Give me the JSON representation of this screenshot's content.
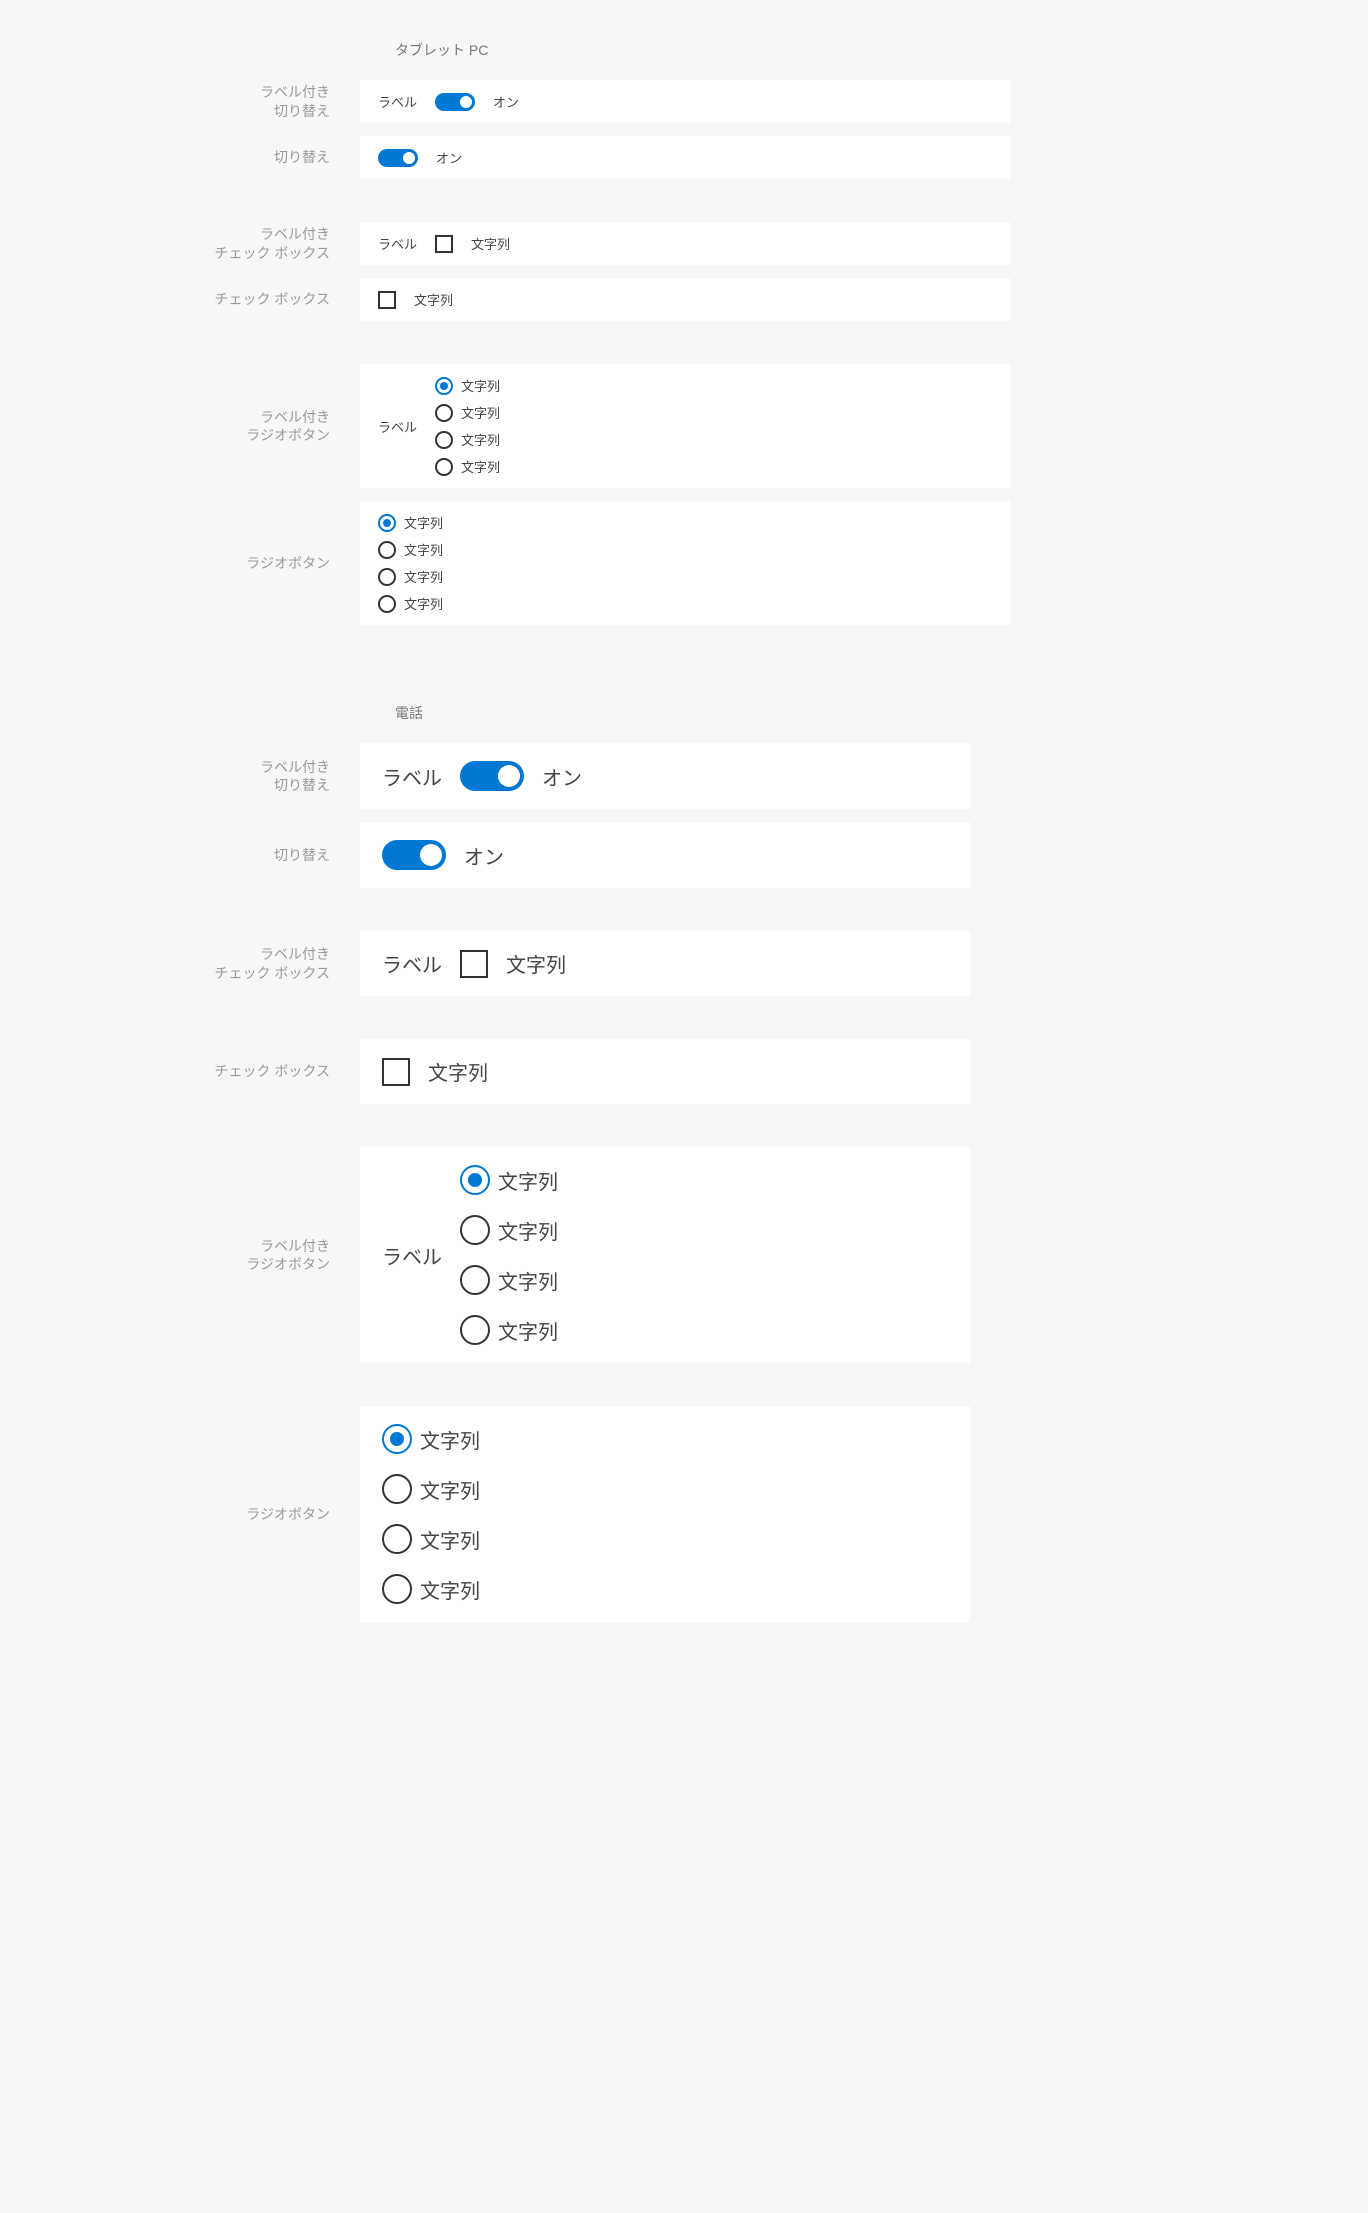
{
  "sections": {
    "tablet": {
      "title": "タブレット PC",
      "rows": {
        "labeledToggle": {
          "rowLabelLine1": "ラベル付き",
          "rowLabelLine2": "切り替え",
          "innerLabel": "ラベル",
          "state": "オン"
        },
        "toggle": {
          "rowLabel": "切り替え",
          "state": "オン"
        },
        "labeledCheckbox": {
          "rowLabelLine1": "ラベル付き",
          "rowLabelLine2": "チェック ボックス",
          "innerLabel": "ラベル",
          "text": "文字列"
        },
        "checkbox": {
          "rowLabel": "チェック ボックス",
          "text": "文字列"
        },
        "labeledRadio": {
          "rowLabelLine1": "ラベル付き",
          "rowLabelLine2": "ラジオボタン",
          "innerLabel": "ラベル",
          "options": [
            "文字列",
            "文字列",
            "文字列",
            "文字列"
          ]
        },
        "radio": {
          "rowLabel": "ラジオボタン",
          "options": [
            "文字列",
            "文字列",
            "文字列",
            "文字列"
          ]
        }
      }
    },
    "phone": {
      "title": "電話",
      "rows": {
        "labeledToggle": {
          "rowLabelLine1": "ラベル付き",
          "rowLabelLine2": "切り替え",
          "innerLabel": "ラベル",
          "state": "オン"
        },
        "toggle": {
          "rowLabel": "切り替え",
          "state": "オン"
        },
        "labeledCheckbox": {
          "rowLabelLine1": "ラベル付き",
          "rowLabelLine2": "チェック ボックス",
          "innerLabel": "ラベル",
          "text": "文字列"
        },
        "checkbox": {
          "rowLabel": "チェック ボックス",
          "text": "文字列"
        },
        "labeledRadio": {
          "rowLabelLine1": "ラベル付き",
          "rowLabelLine2": "ラジオボタン",
          "innerLabel": "ラベル",
          "options": [
            "文字列",
            "文字列",
            "文字列",
            "文字列"
          ]
        },
        "radio": {
          "rowLabel": "ラジオボタン",
          "options": [
            "文字列",
            "文字列",
            "文字列",
            "文字列"
          ]
        }
      }
    }
  },
  "colors": {
    "accent": "#0078d4",
    "bg": "#f7f7f7",
    "card": "#ffffff",
    "muted": "#999999"
  }
}
